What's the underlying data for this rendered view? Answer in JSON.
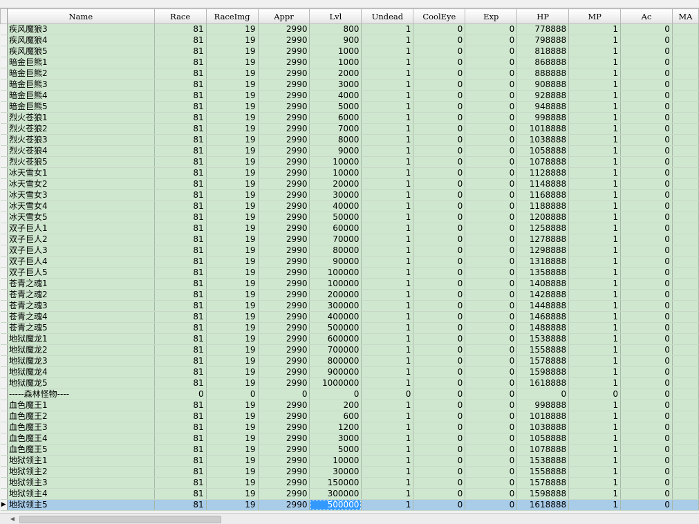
{
  "columns": [
    "Name",
    "Race",
    "RaceImg",
    "Appr",
    "Lvl",
    "Undead",
    "CoolEye",
    "Exp",
    "HP",
    "MP",
    "Ac",
    "MA"
  ],
  "rows": [
    [
      "疾风魔狼3",
      "81",
      "19",
      "2990",
      "800",
      "1",
      "0",
      "0",
      "778888",
      "1",
      "0"
    ],
    [
      "疾风魔狼4",
      "81",
      "19",
      "2990",
      "900",
      "1",
      "0",
      "0",
      "798888",
      "1",
      "0"
    ],
    [
      "疾风魔狼5",
      "81",
      "19",
      "2990",
      "1000",
      "1",
      "0",
      "0",
      "818888",
      "1",
      "0"
    ],
    [
      "暗金巨熊1",
      "81",
      "19",
      "2990",
      "1000",
      "1",
      "0",
      "0",
      "868888",
      "1",
      "0"
    ],
    [
      "暗金巨熊2",
      "81",
      "19",
      "2990",
      "2000",
      "1",
      "0",
      "0",
      "888888",
      "1",
      "0"
    ],
    [
      "暗金巨熊3",
      "81",
      "19",
      "2990",
      "3000",
      "1",
      "0",
      "0",
      "908888",
      "1",
      "0"
    ],
    [
      "暗金巨熊4",
      "81",
      "19",
      "2990",
      "4000",
      "1",
      "0",
      "0",
      "928888",
      "1",
      "0"
    ],
    [
      "暗金巨熊5",
      "81",
      "19",
      "2990",
      "5000",
      "1",
      "0",
      "0",
      "948888",
      "1",
      "0"
    ],
    [
      "烈火苍狼1",
      "81",
      "19",
      "2990",
      "6000",
      "1",
      "0",
      "0",
      "998888",
      "1",
      "0"
    ],
    [
      "烈火苍狼2",
      "81",
      "19",
      "2990",
      "7000",
      "1",
      "0",
      "0",
      "1018888",
      "1",
      "0"
    ],
    [
      "烈火苍狼3",
      "81",
      "19",
      "2990",
      "8000",
      "1",
      "0",
      "0",
      "1038888",
      "1",
      "0"
    ],
    [
      "烈火苍狼4",
      "81",
      "19",
      "2990",
      "9000",
      "1",
      "0",
      "0",
      "1058888",
      "1",
      "0"
    ],
    [
      "烈火苍狼5",
      "81",
      "19",
      "2990",
      "10000",
      "1",
      "0",
      "0",
      "1078888",
      "1",
      "0"
    ],
    [
      "冰天雪女1",
      "81",
      "19",
      "2990",
      "10000",
      "1",
      "0",
      "0",
      "1128888",
      "1",
      "0"
    ],
    [
      "冰天雪女2",
      "81",
      "19",
      "2990",
      "20000",
      "1",
      "0",
      "0",
      "1148888",
      "1",
      "0"
    ],
    [
      "冰天雪女3",
      "81",
      "19",
      "2990",
      "30000",
      "1",
      "0",
      "0",
      "1168888",
      "1",
      "0"
    ],
    [
      "冰天雪女4",
      "81",
      "19",
      "2990",
      "40000",
      "1",
      "0",
      "0",
      "1188888",
      "1",
      "0"
    ],
    [
      "冰天雪女5",
      "81",
      "19",
      "2990",
      "50000",
      "1",
      "0",
      "0",
      "1208888",
      "1",
      "0"
    ],
    [
      "双子巨人1",
      "81",
      "19",
      "2990",
      "60000",
      "1",
      "0",
      "0",
      "1258888",
      "1",
      "0"
    ],
    [
      "双子巨人2",
      "81",
      "19",
      "2990",
      "70000",
      "1",
      "0",
      "0",
      "1278888",
      "1",
      "0"
    ],
    [
      "双子巨人3",
      "81",
      "19",
      "2990",
      "80000",
      "1",
      "0",
      "0",
      "1298888",
      "1",
      "0"
    ],
    [
      "双子巨人4",
      "81",
      "19",
      "2990",
      "90000",
      "1",
      "0",
      "0",
      "1318888",
      "1",
      "0"
    ],
    [
      "双子巨人5",
      "81",
      "19",
      "2990",
      "100000",
      "1",
      "0",
      "0",
      "1358888",
      "1",
      "0"
    ],
    [
      "苍青之魂1",
      "81",
      "19",
      "2990",
      "100000",
      "1",
      "0",
      "0",
      "1408888",
      "1",
      "0"
    ],
    [
      "苍青之魂2",
      "81",
      "19",
      "2990",
      "200000",
      "1",
      "0",
      "0",
      "1428888",
      "1",
      "0"
    ],
    [
      "苍青之魂3",
      "81",
      "19",
      "2990",
      "300000",
      "1",
      "0",
      "0",
      "1448888",
      "1",
      "0"
    ],
    [
      "苍青之魂4",
      "81",
      "19",
      "2990",
      "400000",
      "1",
      "0",
      "0",
      "1468888",
      "1",
      "0"
    ],
    [
      "苍青之魂5",
      "81",
      "19",
      "2990",
      "500000",
      "1",
      "0",
      "0",
      "1488888",
      "1",
      "0"
    ],
    [
      "地狱魔龙1",
      "81",
      "19",
      "2990",
      "600000",
      "1",
      "0",
      "0",
      "1538888",
      "1",
      "0"
    ],
    [
      "地狱魔龙2",
      "81",
      "19",
      "2990",
      "700000",
      "1",
      "0",
      "0",
      "1558888",
      "1",
      "0"
    ],
    [
      "地狱魔龙3",
      "81",
      "19",
      "2990",
      "800000",
      "1",
      "0",
      "0",
      "1578888",
      "1",
      "0"
    ],
    [
      "地狱魔龙4",
      "81",
      "19",
      "2990",
      "900000",
      "1",
      "0",
      "0",
      "1598888",
      "1",
      "0"
    ],
    [
      "地狱魔龙5",
      "81",
      "19",
      "2990",
      "1000000",
      "1",
      "0",
      "0",
      "1618888",
      "1",
      "0"
    ],
    [
      "-----森林怪物----",
      "0",
      "0",
      "0",
      "0",
      "0",
      "0",
      "0",
      "0",
      "0",
      "0"
    ],
    [
      "血色魔王1",
      "81",
      "19",
      "2990",
      "200",
      "1",
      "0",
      "0",
      "998888",
      "1",
      "0"
    ],
    [
      "血色魔王2",
      "81",
      "19",
      "2990",
      "600",
      "1",
      "0",
      "0",
      "1018888",
      "1",
      "0"
    ],
    [
      "血色魔王3",
      "81",
      "19",
      "2990",
      "1200",
      "1",
      "0",
      "0",
      "1038888",
      "1",
      "0"
    ],
    [
      "血色魔王4",
      "81",
      "19",
      "2990",
      "3000",
      "1",
      "0",
      "0",
      "1058888",
      "1",
      "0"
    ],
    [
      "血色魔王5",
      "81",
      "19",
      "2990",
      "5000",
      "1",
      "0",
      "0",
      "1078888",
      "1",
      "0"
    ],
    [
      "地狱领主1",
      "81",
      "19",
      "2990",
      "10000",
      "1",
      "0",
      "0",
      "1538888",
      "1",
      "0"
    ],
    [
      "地狱领主2",
      "81",
      "19",
      "2990",
      "30000",
      "1",
      "0",
      "0",
      "1558888",
      "1",
      "0"
    ],
    [
      "地狱领主3",
      "81",
      "19",
      "2990",
      "150000",
      "1",
      "0",
      "0",
      "1578888",
      "1",
      "0"
    ],
    [
      "地狱领主4",
      "81",
      "19",
      "2990",
      "300000",
      "1",
      "0",
      "0",
      "1598888",
      "1",
      "0"
    ],
    [
      "地狱领主5",
      "81",
      "19",
      "2990",
      "500000",
      "1",
      "0",
      "0",
      "1618888",
      "1",
      "0"
    ]
  ],
  "selection": {
    "row_index": 43,
    "focused_column": "Lvl",
    "row_indicator": "▶"
  },
  "scrollbar": {
    "left_arrow": "◀"
  },
  "colors": {
    "cell_background": "#cfe7cf",
    "selected_row": "#a9cce9",
    "focused_cell": "#3399ff"
  }
}
